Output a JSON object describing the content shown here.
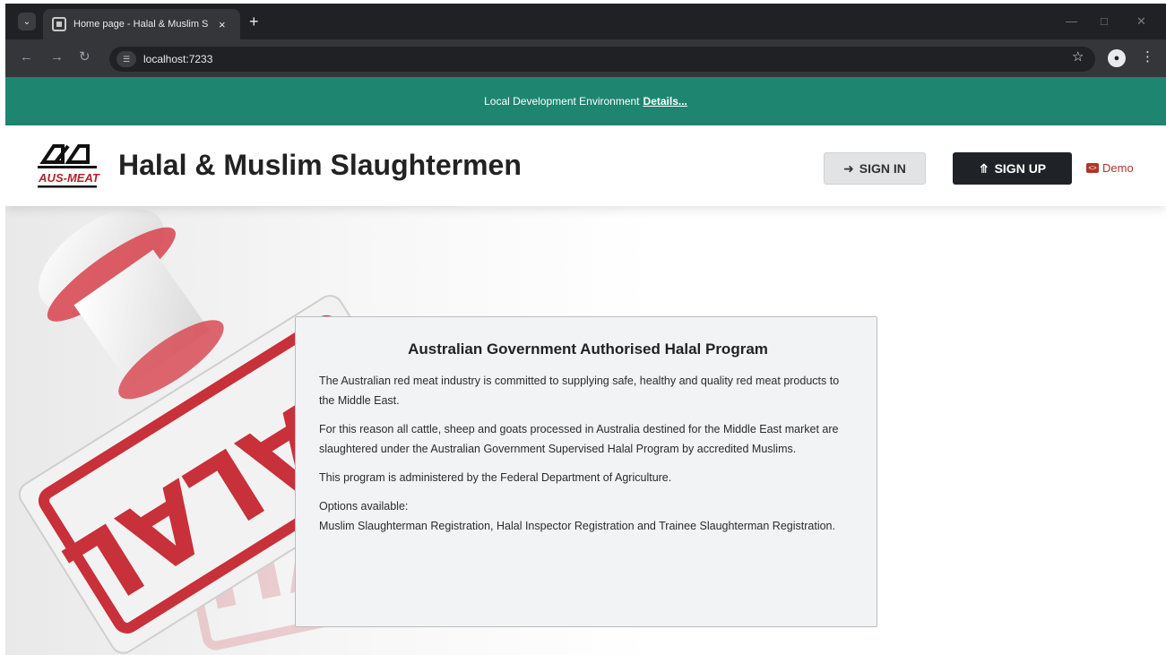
{
  "browser": {
    "tab_title": "Home page - Halal & Muslim S",
    "tab_close": "×",
    "new_tab": "+",
    "url": "localhost:7233",
    "icons": [
      "tab-search-icon",
      "site-favicon-icon",
      "back-icon",
      "forward-icon",
      "reload-icon",
      "site-info-icon",
      "bookmark-star-icon",
      "profile-icon",
      "menu-icon",
      "minimize-icon",
      "maximize-icon",
      "window-close-icon"
    ]
  },
  "env_banner": {
    "text": "Local Development Environment",
    "link": "Details..."
  },
  "header": {
    "logo_text": "AUS-MEAT",
    "title": "Halal & Muslim Slaughtermen",
    "sign_in": "SIGN IN",
    "sign_up": "SIGN UP",
    "demo": "Demo"
  },
  "hero": {
    "stamp_text": "HALAL"
  },
  "card": {
    "title": "Australian Government Authorised Halal Program",
    "p1": "The Australian red meat industry is committed to supplying safe, healthy and quality red meat products to the Middle East.",
    "p2": "For this reason all cattle, sheep and goats processed in Australia destined for the Middle East market are slaughtered under the Australian Government Supervised Halal Program by accredited Muslims.",
    "p3": "This program is administered by the Federal Department of Agriculture.",
    "options_label": "Options available:",
    "options_list": "Muslim Slaughterman Registration, Halal Inspector Registration and Trainee Slaughterman Registration."
  },
  "colors": {
    "env_banner": "#1e8571",
    "signup_button": "#1f2327",
    "signin_button": "#e2e3e5",
    "demo": "#b0342a",
    "stamp_red": "#c8303a"
  }
}
